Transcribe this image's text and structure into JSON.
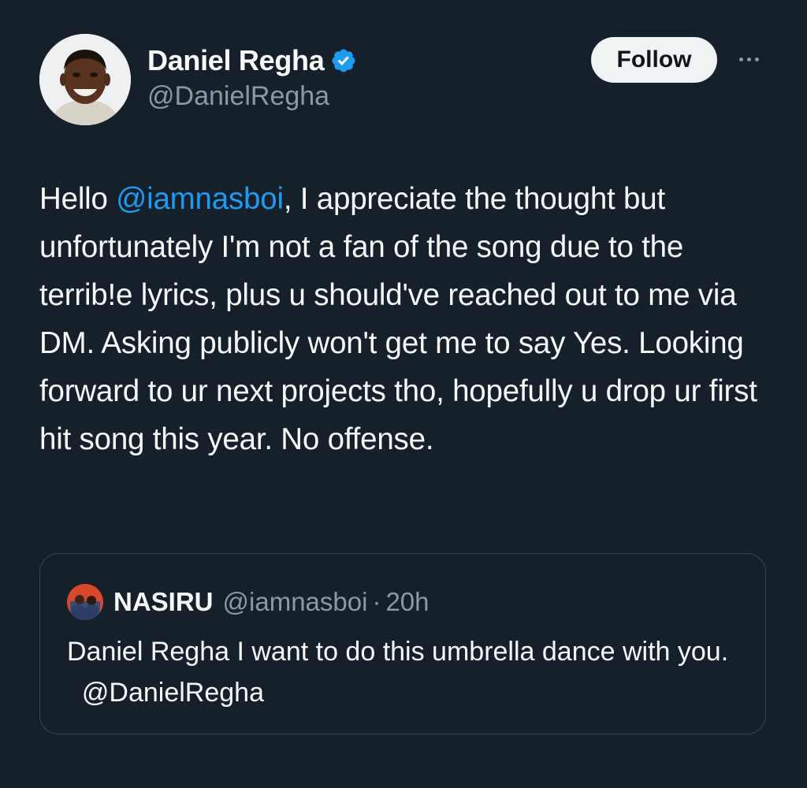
{
  "tweet": {
    "author": {
      "display_name": "Daniel Regha",
      "handle": "@DanielRegha",
      "verified_icon": "verified-badge-icon",
      "avatar_icon": "avatar"
    },
    "follow_label": "Follow",
    "more_icon": "more-options-icon",
    "text": {
      "part1": "Hello ",
      "mention": "@iamnasboi",
      "part2": ", I appreciate the thought but unfortunately I'm not a fan of the song due to the terrib!e lyrics, plus u should've reached out to me via DM. Asking publicly won't get me to say Yes. Looking forward to ur next projects tho, hopefully u drop ur first hit song this year. No offense."
    }
  },
  "quoted_tweet": {
    "display_name": "NASIRU",
    "handle": "@iamnasboi",
    "separator": "·",
    "time": "20h",
    "text_part1": "Daniel Regha I want to do this umbrella dance with you.",
    "text_gap": "  ",
    "text_mention": "@DanielRegha"
  },
  "colors": {
    "background": "#15202b",
    "text_primary": "#f7f9f9",
    "text_secondary": "#8b98a5",
    "link": "#1d9bf0",
    "verified": "#1d9bf0",
    "follow_bg": "#eff3f4",
    "border": "#38444d"
  }
}
